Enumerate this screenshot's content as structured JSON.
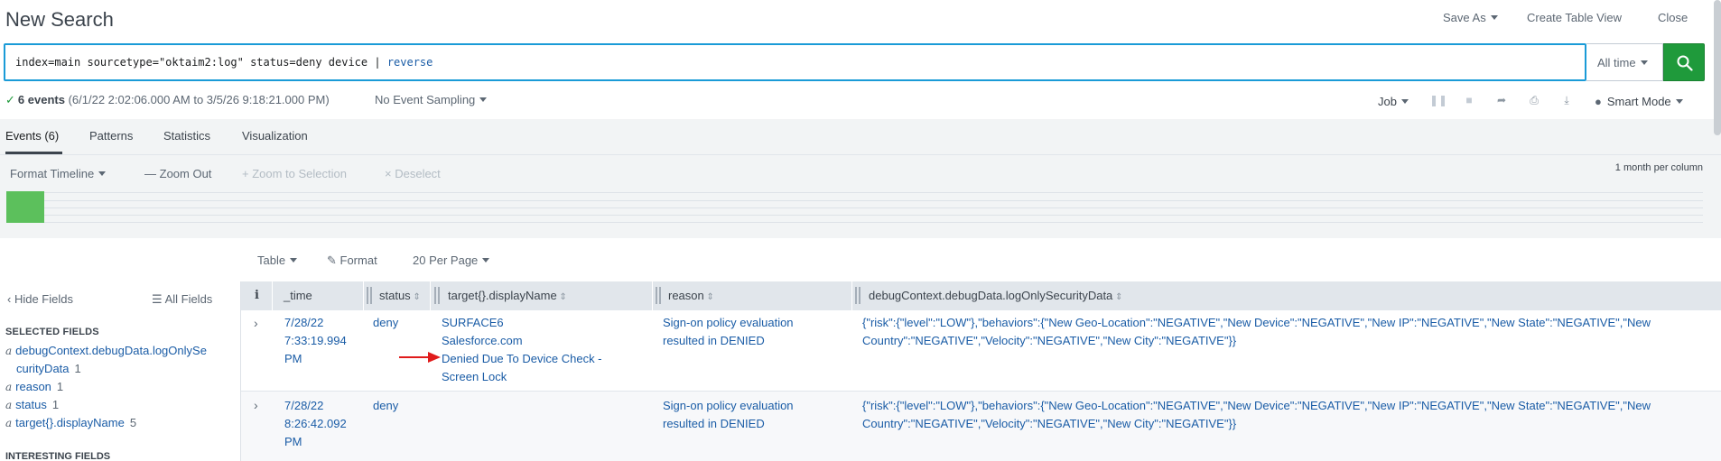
{
  "header": {
    "title": "New Search",
    "save_as": "Save As",
    "create_table_view": "Create Table View",
    "close": "Close"
  },
  "search": {
    "query": "index=main sourcetype=\"oktaim2:log\" status=deny device | ",
    "query_keyword": "reverse",
    "time_range": "All time"
  },
  "status": {
    "check": "✓",
    "count": "6 events",
    "range": "(6/1/22 2:02:06.000 AM to 3/5/26 9:18:21.000 PM)",
    "sampling": "No Event Sampling",
    "job": "Job",
    "mode": "Smart Mode"
  },
  "tabs": [
    {
      "label": "Events (6)"
    },
    {
      "label": "Patterns"
    },
    {
      "label": "Statistics"
    },
    {
      "label": "Visualization"
    }
  ],
  "timeline": {
    "format": "Format Timeline",
    "zoom_out": "Zoom Out",
    "zoom_selection": "Zoom to Selection",
    "deselect": "Deselect",
    "scale": "1 month per column"
  },
  "results_toolbar": {
    "table": "Table",
    "format": "Format",
    "per_page": "20 Per Page"
  },
  "sidebar": {
    "hide_fields": "Hide Fields",
    "all_fields": "All Fields",
    "selected_header": "SELECTED FIELDS",
    "selected": [
      {
        "type": "a",
        "name_line1": "debugContext.debugData.logOnlySe",
        "name_line2": "curityData",
        "count": "1"
      },
      {
        "type": "a",
        "name": "reason",
        "count": "1"
      },
      {
        "type": "a",
        "name": "status",
        "count": "1"
      },
      {
        "type": "a",
        "name": "target{}.displayName",
        "count": "5"
      }
    ],
    "interesting_header": "INTERESTING FIELDS"
  },
  "table": {
    "columns": [
      "i",
      "_time",
      "status",
      "target{}.displayName",
      "reason",
      "debugContext.debugData.logOnlySecurityData"
    ],
    "rows": [
      {
        "time": [
          "7/28/22",
          "7:33:19.994",
          "PM"
        ],
        "status": "deny",
        "target": [
          "SURFACE6",
          "Salesforce.com",
          "Denied Due To Device Check -",
          "Screen Lock"
        ],
        "reason": [
          "Sign-on policy evaluation",
          "resulted in DENIED"
        ],
        "debug": [
          "{\"risk\":{\"level\":\"LOW\"},\"behaviors\":{\"New Geo-Location\":\"NEGATIVE\",\"New Device\":\"NEGATIVE\",\"New IP\":\"NEGATIVE\",\"New State\":\"NEGATIVE\",\"New",
          "Country\":\"NEGATIVE\",\"Velocity\":\"NEGATIVE\",\"New City\":\"NEGATIVE\"}}"
        ]
      },
      {
        "time": [
          "7/28/22",
          "8:26:42.092",
          "PM"
        ],
        "status": "deny",
        "target": [],
        "reason": [
          "Sign-on policy evaluation",
          "resulted in DENIED"
        ],
        "debug": [
          "{\"risk\":{\"level\":\"LOW\"},\"behaviors\":{\"New Geo-Location\":\"NEGATIVE\",\"New Device\":\"NEGATIVE\",\"New IP\":\"NEGATIVE\",\"New State\":\"NEGATIVE\",\"New",
          "Country\":\"NEGATIVE\",\"Velocity\":\"NEGATIVE\",\"New City\":\"NEGATIVE\"}}"
        ]
      }
    ]
  },
  "colors": {
    "accent_blue": "#1a9bd7",
    "search_green": "#1f9a3b",
    "link_blue": "#1a5ca6",
    "timeline_green": "#5cc05c",
    "annotation_red": "#e01b1b"
  }
}
